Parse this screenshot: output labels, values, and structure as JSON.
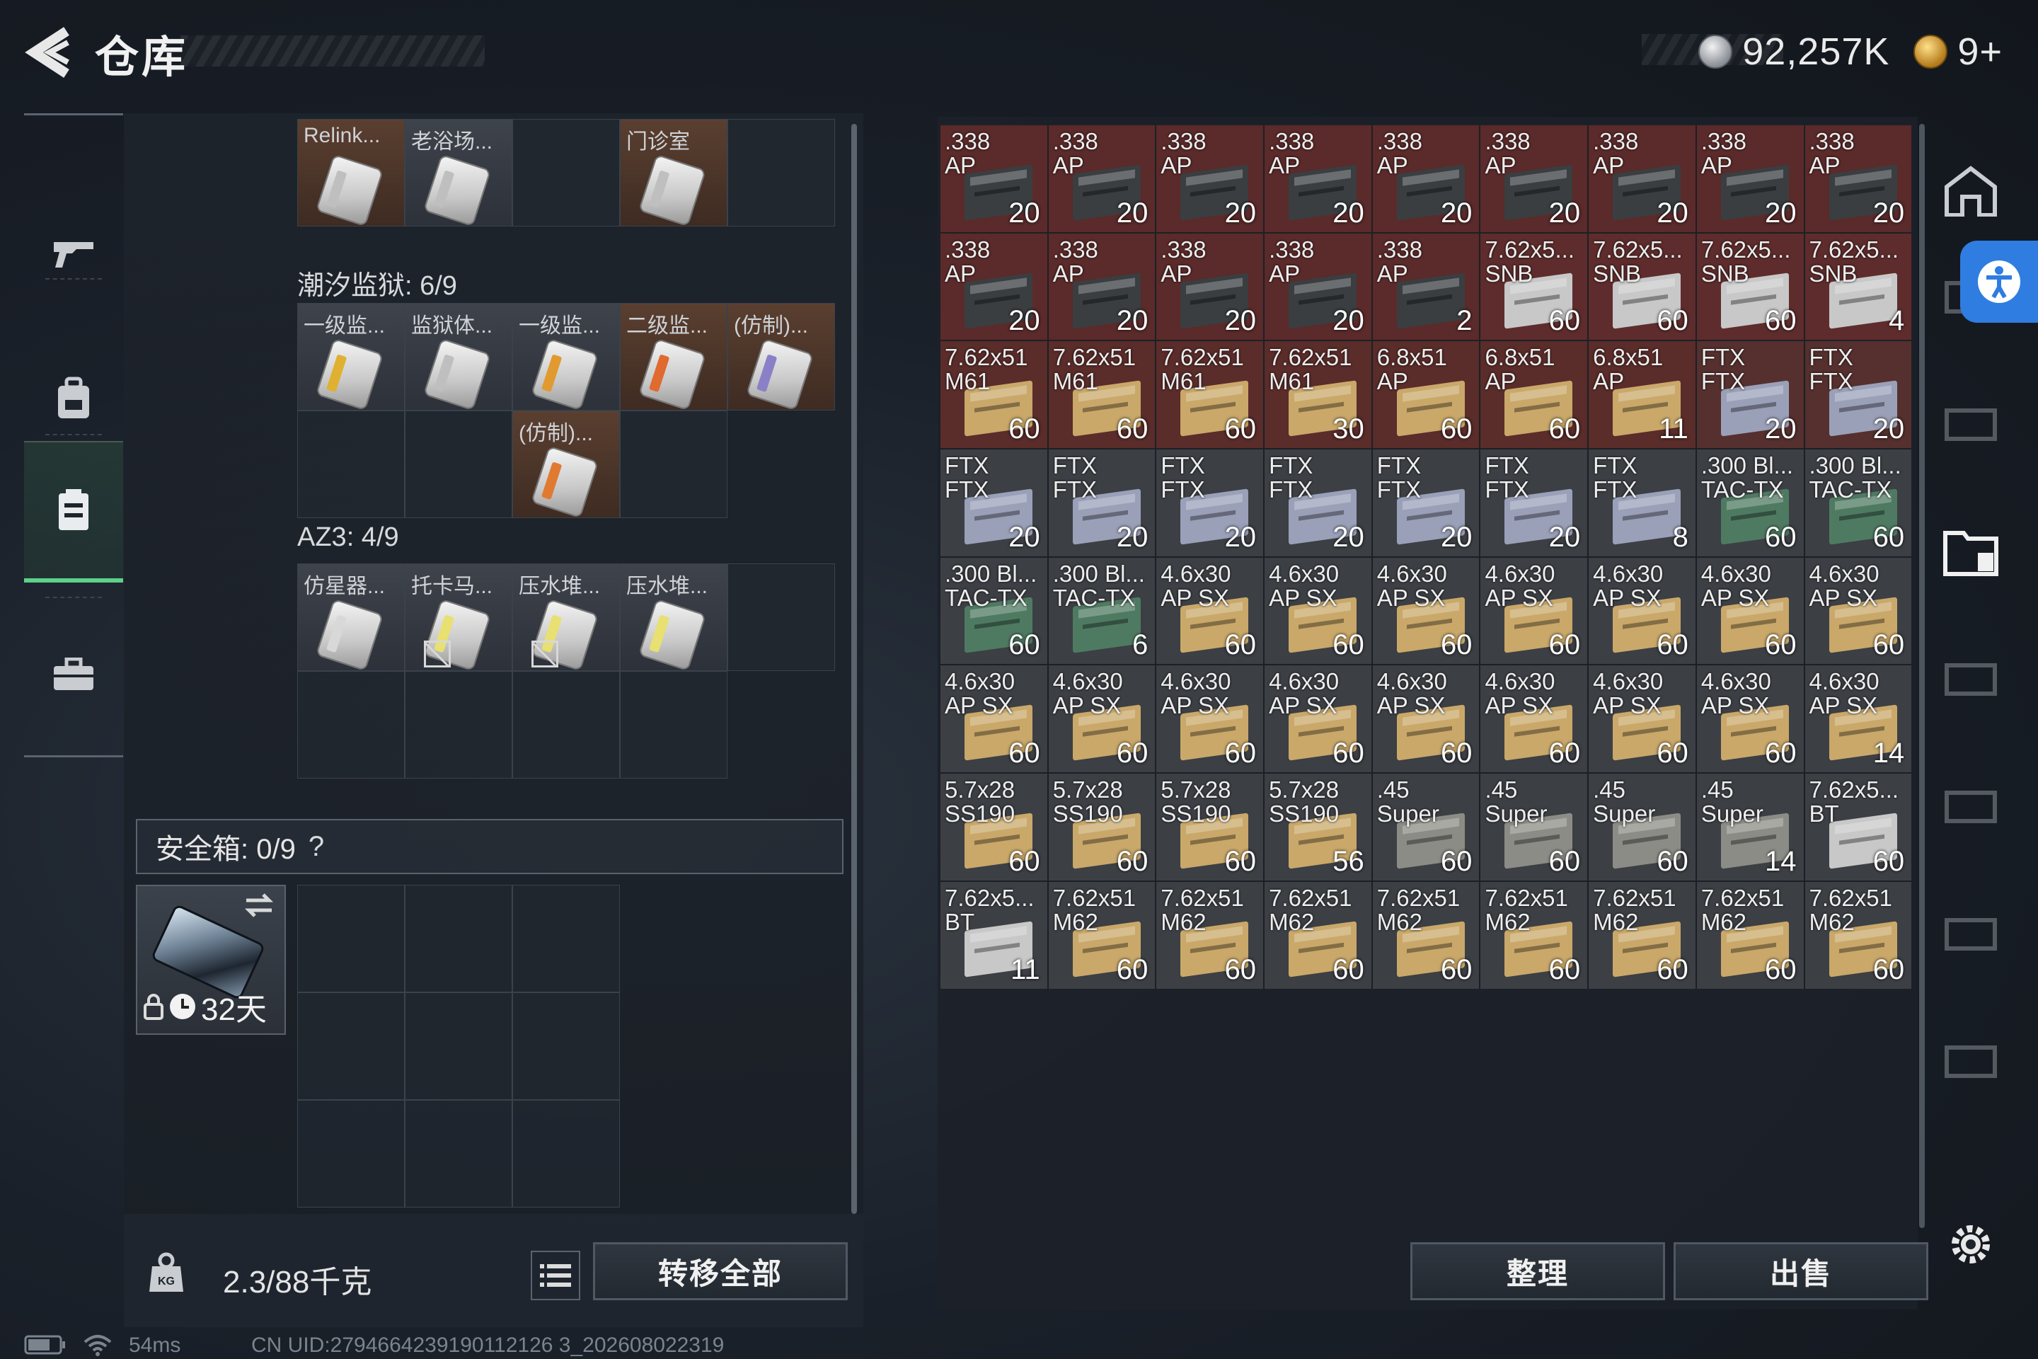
{
  "header": {
    "title": "仓库"
  },
  "currency": {
    "silver": "92,257K",
    "gold": "9+"
  },
  "left_nav": [
    "gun-icon",
    "backpack-icon",
    "vest-icon",
    "case-icon"
  ],
  "containers": [
    {
      "id": "c0",
      "label": "",
      "cols": 5,
      "rows": 1,
      "cells": [
        {
          "label": "Relink...",
          "style": "filled-brown",
          "card": "#bfbfbf"
        },
        {
          "label": "老浴场...",
          "style": "filled-gray",
          "card": "#bfbfbf"
        },
        {
          "label": "",
          "style": "",
          "card": ""
        },
        {
          "label": "门诊室",
          "style": "filled-brown",
          "card": "#bfbfbf"
        },
        {
          "label": "",
          "style": "",
          "card": ""
        }
      ]
    },
    {
      "id": "c1",
      "label": "潮汐监狱: 6/9",
      "cols": 5,
      "rows": 2,
      "cells": [
        {
          "label": "一级监...",
          "style": "filled-gray",
          "card": "#e0b030"
        },
        {
          "label": "监狱体...",
          "style": "filled-gray",
          "card": "#bfbfbf"
        },
        {
          "label": "一级监...",
          "style": "filled-gray",
          "card": "#e09a30"
        },
        {
          "label": "二级监...",
          "style": "filled-brown",
          "card": "#e06a30"
        },
        {
          "label": "(仿制)...",
          "style": "filled-brown",
          "card": "#8a80c8"
        },
        {
          "label": "",
          "style": "",
          "card": ""
        },
        {
          "label": "",
          "style": "",
          "card": ""
        },
        {
          "label": "(仿制)...",
          "style": "filled-brown",
          "card": "#e07a30"
        },
        {
          "label": "",
          "style": "",
          "card": ""
        }
      ]
    },
    {
      "id": "c2",
      "label": "AZ3: 4/9",
      "cols": 5,
      "rows": 2,
      "cells": [
        {
          "label": "仿星器...",
          "style": "filled-gray",
          "card": "#d8d8d8",
          "locked": false
        },
        {
          "label": "托卡马...",
          "style": "filled-gray",
          "card": "#e8e070",
          "locked": true
        },
        {
          "label": "压水堆...",
          "style": "filled-gray",
          "card": "#e8e070",
          "locked": true
        },
        {
          "label": "压水堆...",
          "style": "filled-gray",
          "card": "#e8e070",
          "locked": false
        },
        {
          "label": "",
          "style": "",
          "card": ""
        },
        {
          "label": "",
          "style": "",
          "card": ""
        },
        {
          "label": "",
          "style": "",
          "card": ""
        },
        {
          "label": "",
          "style": "",
          "card": ""
        },
        {
          "label": "",
          "style": "",
          "card": ""
        }
      ]
    }
  ],
  "safe_box": {
    "label": "安全箱: 0/9",
    "help": "?",
    "item_days": "32天"
  },
  "footer_left": {
    "weight": "2.3/88千克",
    "transfer_all": "转移全部"
  },
  "footer_right": {
    "sort": "整理",
    "sell": "出售"
  },
  "status": {
    "ping": "54ms",
    "uid": "CN UID:2794664239190112126 3_202608022319"
  },
  "stash": [
    {
      "n1": ".338",
      "n2": "AP",
      "c": "20",
      "t": "red"
    },
    {
      "n1": ".338",
      "n2": "AP",
      "c": "20",
      "t": "red"
    },
    {
      "n1": ".338",
      "n2": "AP",
      "c": "20",
      "t": "red"
    },
    {
      "n1": ".338",
      "n2": "AP",
      "c": "20",
      "t": "red"
    },
    {
      "n1": ".338",
      "n2": "AP",
      "c": "20",
      "t": "red"
    },
    {
      "n1": ".338",
      "n2": "AP",
      "c": "20",
      "t": "red"
    },
    {
      "n1": ".338",
      "n2": "AP",
      "c": "20",
      "t": "red"
    },
    {
      "n1": ".338",
      "n2": "AP",
      "c": "20",
      "t": "red"
    },
    {
      "n1": ".338",
      "n2": "AP",
      "c": "20",
      "t": "red"
    },
    {
      "n1": ".338",
      "n2": "AP",
      "c": "20",
      "t": "red"
    },
    {
      "n1": ".338",
      "n2": "AP",
      "c": "20",
      "t": "red"
    },
    {
      "n1": ".338",
      "n2": "AP",
      "c": "20",
      "t": "red"
    },
    {
      "n1": ".338",
      "n2": "AP",
      "c": "20",
      "t": "red"
    },
    {
      "n1": ".338",
      "n2": "AP",
      "c": "2",
      "t": "red"
    },
    {
      "n1": "7.62x5...",
      "n2": "SNB",
      "c": "60",
      "t": "red2"
    },
    {
      "n1": "7.62x5...",
      "n2": "SNB",
      "c": "60",
      "t": "red2"
    },
    {
      "n1": "7.62x5...",
      "n2": "SNB",
      "c": "60",
      "t": "red2"
    },
    {
      "n1": "7.62x5...",
      "n2": "SNB",
      "c": "4",
      "t": "red2"
    },
    {
      "n1": "7.62x51",
      "n2": "M61",
      "c": "60",
      "t": "red3"
    },
    {
      "n1": "7.62x51",
      "n2": "M61",
      "c": "60",
      "t": "red3"
    },
    {
      "n1": "7.62x51",
      "n2": "M61",
      "c": "60",
      "t": "red3"
    },
    {
      "n1": "7.62x51",
      "n2": "M61",
      "c": "30",
      "t": "red3"
    },
    {
      "n1": "6.8x51",
      "n2": "AP",
      "c": "60",
      "t": "red3"
    },
    {
      "n1": "6.8x51",
      "n2": "AP",
      "c": "60",
      "t": "red3"
    },
    {
      "n1": "6.8x51",
      "n2": "AP",
      "c": "11",
      "t": "red3"
    },
    {
      "n1": "FTX",
      "n2": "FTX",
      "c": "20",
      "t": "red4"
    },
    {
      "n1": "FTX",
      "n2": "FTX",
      "c": "20",
      "t": "red4"
    },
    {
      "n1": "FTX",
      "n2": "FTX",
      "c": "20",
      "t": "gray"
    },
    {
      "n1": "FTX",
      "n2": "FTX",
      "c": "20",
      "t": "gray"
    },
    {
      "n1": "FTX",
      "n2": "FTX",
      "c": "20",
      "t": "gray"
    },
    {
      "n1": "FTX",
      "n2": "FTX",
      "c": "20",
      "t": "gray"
    },
    {
      "n1": "FTX",
      "n2": "FTX",
      "c": "20",
      "t": "gray"
    },
    {
      "n1": "FTX",
      "n2": "FTX",
      "c": "20",
      "t": "gray"
    },
    {
      "n1": "FTX",
      "n2": "FTX",
      "c": "8",
      "t": "gray"
    },
    {
      "n1": ".300 Bl...",
      "n2": "TAC-TX",
      "c": "60",
      "t": "gray"
    },
    {
      "n1": ".300 Bl...",
      "n2": "TAC-TX",
      "c": "60",
      "t": "gray"
    },
    {
      "n1": ".300 Bl...",
      "n2": "TAC-TX",
      "c": "60",
      "t": "gray"
    },
    {
      "n1": ".300 Bl...",
      "n2": "TAC-TX",
      "c": "6",
      "t": "gray"
    },
    {
      "n1": "4.6x30",
      "n2": "AP SX",
      "c": "60",
      "t": "gray"
    },
    {
      "n1": "4.6x30",
      "n2": "AP SX",
      "c": "60",
      "t": "gray"
    },
    {
      "n1": "4.6x30",
      "n2": "AP SX",
      "c": "60",
      "t": "gray"
    },
    {
      "n1": "4.6x30",
      "n2": "AP SX",
      "c": "60",
      "t": "gray"
    },
    {
      "n1": "4.6x30",
      "n2": "AP SX",
      "c": "60",
      "t": "gray"
    },
    {
      "n1": "4.6x30",
      "n2": "AP SX",
      "c": "60",
      "t": "gray"
    },
    {
      "n1": "4.6x30",
      "n2": "AP SX",
      "c": "60",
      "t": "gray"
    },
    {
      "n1": "4.6x30",
      "n2": "AP SX",
      "c": "60",
      "t": "gray"
    },
    {
      "n1": "4.6x30",
      "n2": "AP SX",
      "c": "60",
      "t": "gray"
    },
    {
      "n1": "4.6x30",
      "n2": "AP SX",
      "c": "60",
      "t": "gray"
    },
    {
      "n1": "4.6x30",
      "n2": "AP SX",
      "c": "60",
      "t": "gray"
    },
    {
      "n1": "4.6x30",
      "n2": "AP SX",
      "c": "60",
      "t": "gray"
    },
    {
      "n1": "4.6x30",
      "n2": "AP SX",
      "c": "60",
      "t": "gray"
    },
    {
      "n1": "4.6x30",
      "n2": "AP SX",
      "c": "60",
      "t": "gray"
    },
    {
      "n1": "4.6x30",
      "n2": "AP SX",
      "c": "60",
      "t": "gray"
    },
    {
      "n1": "4.6x30",
      "n2": "AP SX",
      "c": "14",
      "t": "gray"
    },
    {
      "n1": "5.7x28",
      "n2": "SS190",
      "c": "60",
      "t": "gray"
    },
    {
      "n1": "5.7x28",
      "n2": "SS190",
      "c": "60",
      "t": "gray"
    },
    {
      "n1": "5.7x28",
      "n2": "SS190",
      "c": "60",
      "t": "gray"
    },
    {
      "n1": "5.7x28",
      "n2": "SS190",
      "c": "56",
      "t": "gray"
    },
    {
      "n1": ".45",
      "n2": "Super",
      "c": "60",
      "t": "gray"
    },
    {
      "n1": ".45",
      "n2": "Super",
      "c": "60",
      "t": "gray"
    },
    {
      "n1": ".45",
      "n2": "Super",
      "c": "60",
      "t": "gray"
    },
    {
      "n1": ".45",
      "n2": "Super",
      "c": "14",
      "t": "gray"
    },
    {
      "n1": "7.62x5...",
      "n2": "BT",
      "c": "60",
      "t": "gray"
    },
    {
      "n1": "7.62x5...",
      "n2": "BT",
      "c": "11",
      "t": "gray"
    },
    {
      "n1": "7.62x51",
      "n2": "M62",
      "c": "60",
      "t": "gray"
    },
    {
      "n1": "7.62x51",
      "n2": "M62",
      "c": "60",
      "t": "gray"
    },
    {
      "n1": "7.62x51",
      "n2": "M62",
      "c": "60",
      "t": "gray"
    },
    {
      "n1": "7.62x51",
      "n2": "M62",
      "c": "60",
      "t": "gray"
    },
    {
      "n1": "7.62x51",
      "n2": "M62",
      "c": "60",
      "t": "gray"
    },
    {
      "n1": "7.62x51",
      "n2": "M62",
      "c": "60",
      "t": "gray"
    },
    {
      "n1": "7.62x51",
      "n2": "M62",
      "c": "60",
      "t": "gray"
    },
    {
      "n1": "7.62x51",
      "n2": "M62",
      "c": "60",
      "t": "gray"
    }
  ],
  "colors": {
    "red": "#5b2a2a",
    "red2": "#5e2c2c",
    "red3": "#5a2c2a",
    "red4": "#55302e",
    "gray": "#3c3f44",
    "accent_green": "#5fd08a",
    "accent_blue": "#2f7de0"
  }
}
